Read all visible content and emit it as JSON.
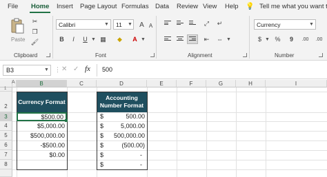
{
  "tabs": [
    "File",
    "Home",
    "Insert",
    "Page Layout",
    "Formulas",
    "Data",
    "Review",
    "View",
    "Help"
  ],
  "tell_me": "Tell me what you want t",
  "ribbon": {
    "clipboard": {
      "paste_label": "Paste",
      "group_label": "Clipboard"
    },
    "font": {
      "name": "Calibri",
      "size": "11",
      "bold": "B",
      "italic": "I",
      "underline": "U",
      "grow": "A",
      "shrink": "A",
      "group_label": "Font"
    },
    "alignment": {
      "group_label": "Alignment"
    },
    "number": {
      "format": "Currency",
      "currency_symbol": "$",
      "percent": "%",
      "comma": "9",
      "dec_increase": ".00",
      "dec_decrease": ".00",
      "group_label": "Number"
    }
  },
  "formula_bar": {
    "name_box": "B3",
    "fx": "fx",
    "value": "500"
  },
  "columns": [
    "A",
    "B",
    "C",
    "D",
    "E",
    "F",
    "G",
    "H",
    "I"
  ],
  "rows": [
    "1",
    "2",
    "3",
    "4",
    "5",
    "6",
    "7",
    "8"
  ],
  "table_b": {
    "header": "Currency Format",
    "values": [
      "$500.00",
      "$5,000.00",
      "$500,000.00",
      "-$500.00",
      "$0.00",
      ""
    ]
  },
  "table_d": {
    "header_line1": "Accounting",
    "header_line2": "Number Format",
    "symbols": [
      "$",
      "$",
      "$",
      "$",
      "$",
      "$"
    ],
    "values": [
      "500.00",
      "5,000.00",
      "500,000.00",
      "(500.00)",
      "-",
      "-"
    ]
  },
  "colors": {
    "accent": "#217346",
    "header_fill": "#1f4f5f",
    "ribbon_bg": "#f3f3f3"
  }
}
